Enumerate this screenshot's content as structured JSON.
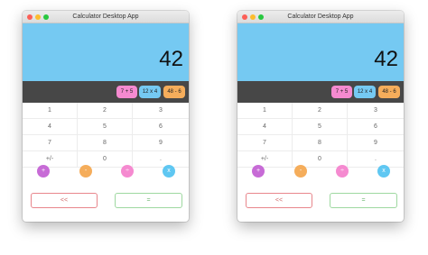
{
  "colors": {
    "display_bg": "#75c9f2",
    "opbar_bg": "#474747",
    "chip_add": "#f58ad0",
    "chip_mul": "#75c9f2",
    "chip_sub": "#f5ad5b",
    "op_add": "#c76bd6",
    "op_sub": "#f5ad5b",
    "op_div": "#f58ad0",
    "op_mul": "#5fc7f2",
    "back_border": "#e8868c",
    "back_text": "#d06868",
    "eq_border": "#9ed8a0",
    "eq_text": "#6ab56e",
    "light_red": "#fc5f57",
    "light_yellow": "#fdbc2e",
    "light_green": "#28c840"
  },
  "windows": [
    {
      "title": "Calculator Desktop App",
      "display": "42",
      "chips": [
        "7 + 5",
        "12 x 4",
        "48 - 6"
      ],
      "keypad": [
        [
          "1",
          "2",
          "3"
        ],
        [
          "4",
          "5",
          "6"
        ],
        [
          "7",
          "8",
          "9"
        ],
        [
          "+/-",
          "0",
          "."
        ]
      ],
      "operators": [
        "+",
        "-",
        "÷",
        "x"
      ],
      "back_label": "<<",
      "equals_label": "="
    },
    {
      "title": "Calculator Desktop App",
      "display": "42",
      "chips": [
        "7 + 5",
        "12 x 4",
        "48 - 6"
      ],
      "keypad": [
        [
          "1",
          "2",
          "3"
        ],
        [
          "4",
          "5",
          "6"
        ],
        [
          "7",
          "8",
          "9"
        ],
        [
          "+/-",
          "0",
          "."
        ]
      ],
      "operators": [
        "+",
        "-",
        "÷",
        "x"
      ],
      "back_label": "<<",
      "equals_label": "="
    }
  ]
}
